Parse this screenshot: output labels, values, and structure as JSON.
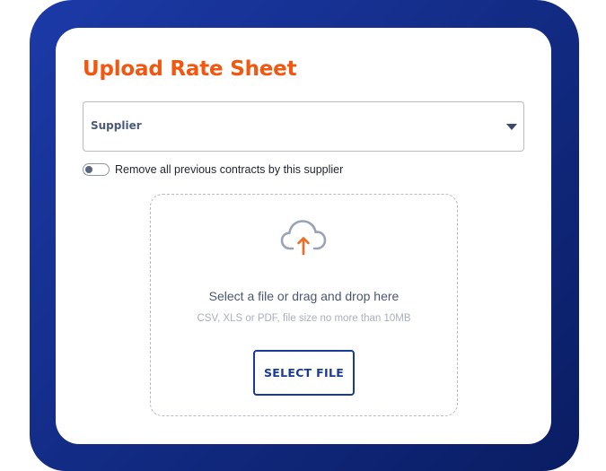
{
  "upload_dialog": {
    "title": "Upload Rate Sheet",
    "supplier_select": {
      "label": "Supplier",
      "icon": "caret-down-icon"
    },
    "remove_contracts_toggle": {
      "label": "Remove all previous contracts by this supplier",
      "checked": false
    },
    "dropzone": {
      "icon": "cloud-upload-icon",
      "primary_text": "Select a file or drag and drop here",
      "hint_text": "CSV, XLS or PDF, file size no more than 10MB",
      "select_button_label": "SELECT FILE"
    }
  },
  "colors": {
    "frame_gradient_start": "#1c3aa8",
    "frame_gradient_end": "#0a1d63",
    "title_orange": "#f2560f",
    "button_blue": "#1a3a9a",
    "upload_arrow_orange": "#f26a1f",
    "cloud_outline": "#9aa3b5"
  }
}
